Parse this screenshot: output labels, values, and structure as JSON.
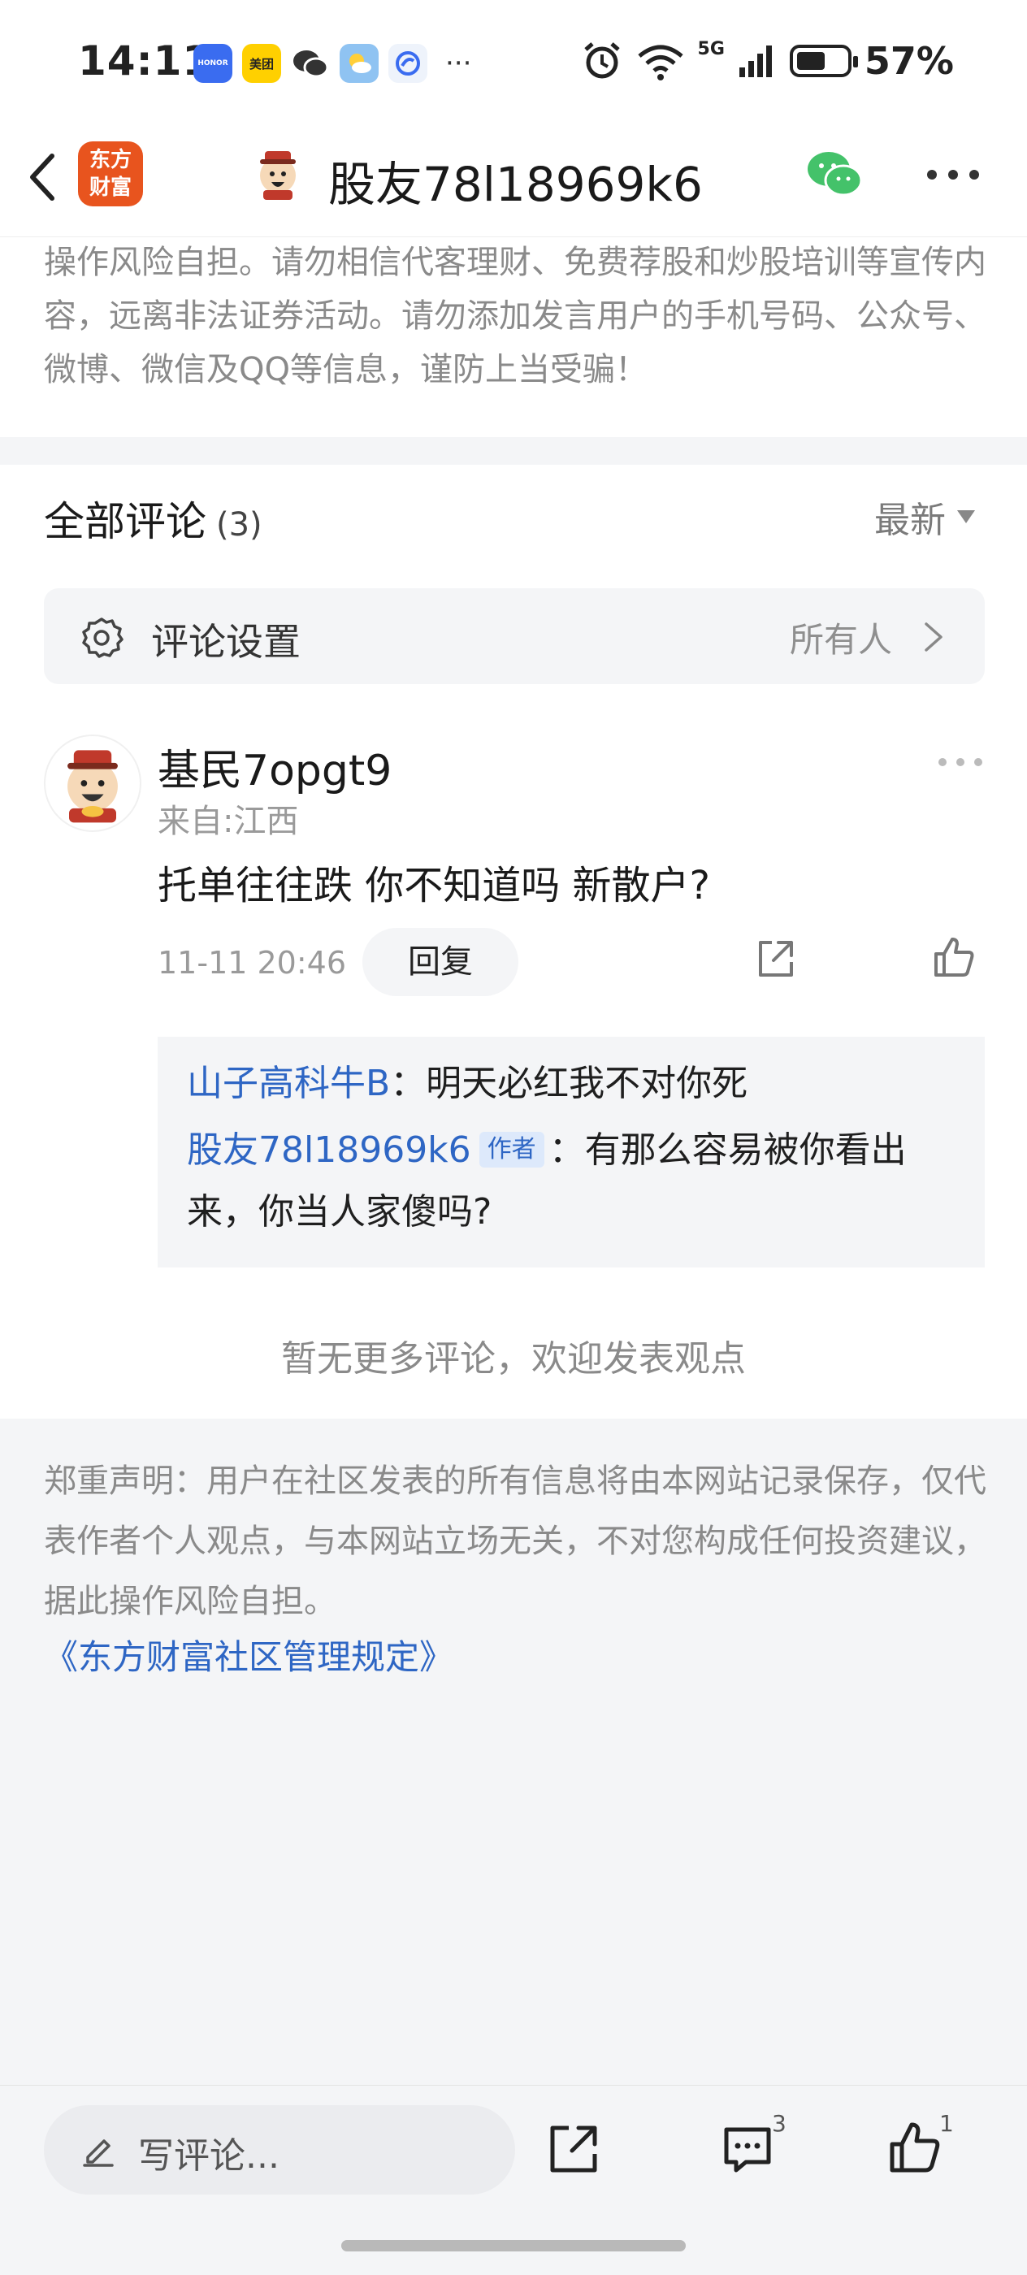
{
  "status_bar": {
    "time": "14:11",
    "apps": [
      {
        "name": "honor-app-icon",
        "label": "HONOR",
        "bg": "#3a6cf0",
        "fg": "#ffffff"
      },
      {
        "name": "meituan-app-icon",
        "label": "美团",
        "bg": "#ffd000",
        "fg": "#222222"
      },
      {
        "name": "wechat-app-icon",
        "label": "",
        "bg": "#ffffff",
        "fg": "#222222"
      },
      {
        "name": "weather-app-icon",
        "label": "",
        "bg": "#8fc3f2",
        "fg": "#ffffff"
      },
      {
        "name": "browser-app-icon",
        "label": "",
        "bg": "#eef3fb",
        "fg": "#3a6cf0"
      }
    ],
    "overflow": "···",
    "network": "5G",
    "battery_percent": "57%",
    "battery_level": 0.57
  },
  "nav": {
    "logo_line1": "东方",
    "logo_line2": "财富",
    "title": "股友78l18969k6"
  },
  "notice": {
    "text": "操作风险自担。请勿相信代客理财、免费荐股和炒股培训等宣传内容，远离非法证券活动。请勿添加发言用户的手机号码、公众号、微博、微信及QQ等信息，谨防上当受骗！"
  },
  "comments_header": {
    "title": "全部评论",
    "count": "(3)",
    "sort": "最新"
  },
  "settings": {
    "label": "评论设置",
    "value": "所有人"
  },
  "comment": {
    "username": "基民7opgt9",
    "location": "来自:江西",
    "text": "托单往往跌 你不知道吗 新散户?",
    "time": "11-11 20:46",
    "reply_label": "回复"
  },
  "replies": [
    {
      "user": "山子高科牛B",
      "badge": "",
      "text": "：明天必红我不对你死"
    },
    {
      "user": "股友78l18969k6",
      "badge": "作者",
      "text": "：有那么容易被你看出来，你当人家傻吗?"
    }
  ],
  "no_more": "暂无更多评论，欢迎发表观点",
  "disclaimer": {
    "text": "郑重声明：用户在社区发表的所有信息将由本网站记录保存，仅代表作者个人观点，与本网站立场无关，不对您构成任何投资建议，据此操作风险自担。",
    "link": "《东方财富社区管理规定》"
  },
  "bottom_bar": {
    "placeholder": "写评论...",
    "comment_count": "3",
    "like_count": "1"
  },
  "colors": {
    "link_blue": "#2e66c4",
    "brand_orange": "#e8541e",
    "wechat_green": "#44c26a"
  }
}
